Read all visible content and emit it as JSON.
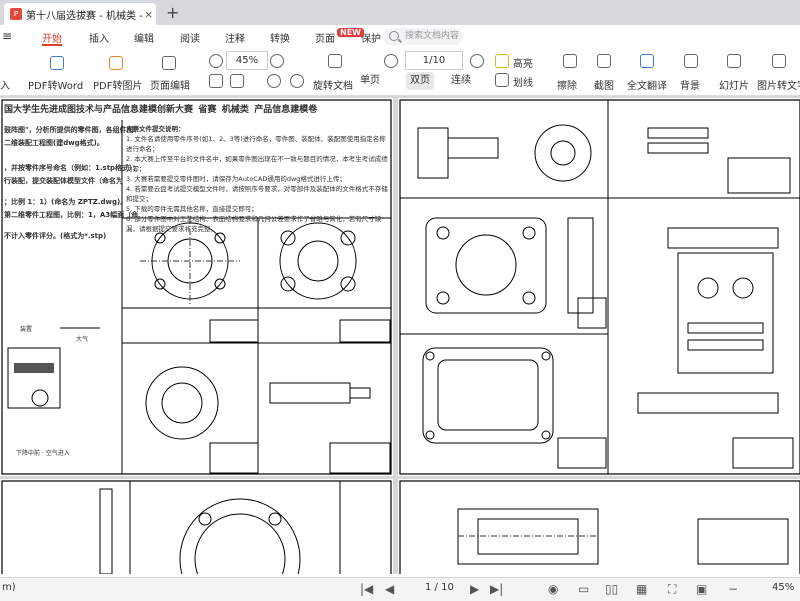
{
  "window": {
    "tab_title": "第十八届选拔赛 - 机械类 - 省...",
    "tab_close": "×",
    "new_tab": "+"
  },
  "menu": {
    "items": [
      "开始",
      "插入",
      "编辑",
      "阅读",
      "注释",
      "转换",
      "页面",
      "保护"
    ],
    "new_badge": "NEW",
    "search_placeholder": "搜索文档内容"
  },
  "toolbar": {
    "row1": {
      "pdf_to_word": "PDF转Word",
      "pdf_to_image": "PDF转图片",
      "page_edit": "页面编辑",
      "zoom": "45%",
      "page_indicator": "1/10",
      "highlight": "高亮",
      "underline": "划线",
      "erase": "擦除",
      "screenshot": "截图",
      "translate": "全文翻译",
      "background": "背景",
      "slideshow": "幻灯片",
      "image_to_text": "图片转文字"
    },
    "row2": {
      "rotate": "旋转文档",
      "single_page": "单页",
      "double_page": "双页",
      "continuous": "连续"
    },
    "left_cut": "入"
  },
  "document": {
    "page1": {
      "title": "国大学生先进成图技术与产品信息建模创新大赛   省赛   机械类   产品信息建模卷",
      "left_text": [
        "鼓阵图\"，分析所提供的零件图，各组件图、",
        "二维装配工程图(建dwg格式)。",
        "，并按零件序号命名（例如：1.stp格式）；",
        "行装配，提交装配体模型文件（命名为",
        "；比例 1：1）(命名为 ZPTZ.dwg)。",
        "第二维零件工程图，比例：1，A3幅面（命",
        "不计入零件评分。(格式为*.stp)"
      ],
      "rules_title": "大赛文件提交说明：",
      "rules": [
        "1. 文件名请使用零件序号(如1、2、3等)进行命名，零件图、装配体、装配图使用指定名称进行命名；",
        "2. 本大赛上传至平台的文件名中，如果零件图出现在不一致与题目的情况，本考生考试成绩为零；",
        "3. 大赛若需要提交零件图时，请保存为AutoCAD通用的dwg格式进行上传；",
        "4. 若需要云盘考试提交模型文件时，请按照序号要求，对零部件及装配体的文件格式不存储和提交；",
        "5. 下载的零件无需其他名称，直接提交即可；",
        "6. 部分零件图中对工艺结构、表面结构要求和几何公差要求作了省略与简化，若有尺寸缺漏，请根据提交要求补充完整。"
      ],
      "side_notes": [
        "装置",
        "大气",
        "下降中前 · 空气进入"
      ]
    }
  },
  "statusbar": {
    "left_text": "m)",
    "page": "1 / 10",
    "zoom": "45%"
  }
}
